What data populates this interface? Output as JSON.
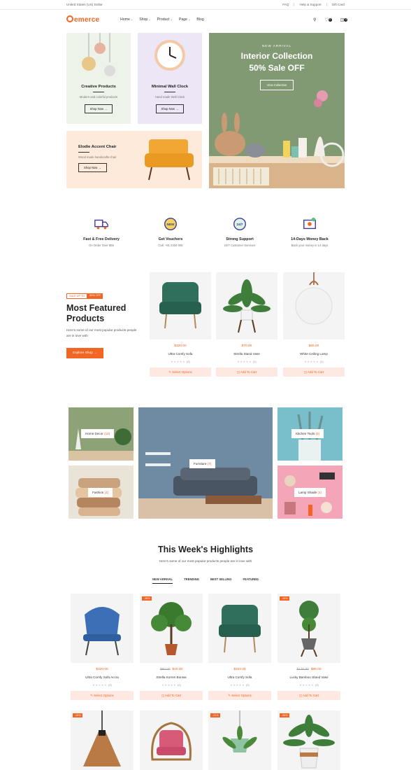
{
  "topbar": {
    "region": "United States (US) Dollar",
    "links": [
      "FAQ",
      "Help & Support",
      "Gift Card"
    ]
  },
  "header": {
    "logo": "emerce",
    "nav": [
      "Home",
      "Shop",
      "Product",
      "Page",
      "Blog"
    ],
    "wishlist_count": "0",
    "cart_count": "0"
  },
  "hero": {
    "card1": {
      "title": "Creative Products",
      "sub": "Modern and colorful products",
      "btn": "Shop Now"
    },
    "card2": {
      "title": "Minimal Wall Clock",
      "sub": "Hand made Wall Clock",
      "btn": "Shop Now"
    },
    "card3": {
      "title": "Elodie Accent Chair",
      "sub": "Wood made handicrafts chair",
      "btn": "Shop Now"
    },
    "main": {
      "eyebrow": "NEW ARRIVAL",
      "title1": "Interior Collection",
      "title2": "50% Sale OFF",
      "btn": "View Collection"
    }
  },
  "features": [
    {
      "title": "Fast & Free Delivery",
      "sub": "On Order Over $55"
    },
    {
      "title": "Get Vouchers",
      "sub": "Call: +91 2334 005"
    },
    {
      "title": "Strong Support",
      "sub": "24/7 Customer Services"
    },
    {
      "title": "14-Days Money Back",
      "sub": "Back your money in 14 days"
    }
  ],
  "featured": {
    "tag1": "SALE UP TO",
    "tag2": "50% OFF",
    "title1": "Most Featured",
    "title2": "Products",
    "desc": "Here's some of our most popular products people are in love with",
    "btn": "Explore Shop",
    "products": [
      {
        "price": "$320.00",
        "name": "Ultra Comfy Sofa",
        "reviews": "(0)",
        "action": "Select Options"
      },
      {
        "price": "$70.00",
        "name": "Strella Stand Vase",
        "reviews": "(0)",
        "action": "Add To Cart"
      },
      {
        "price": "$65.00",
        "name": "White Ceiling Lamp",
        "reviews": "(0)",
        "action": "Add To Cart"
      }
    ]
  },
  "categories": [
    {
      "name": "Home Decor",
      "count": "(10)"
    },
    {
      "name": "Fashion",
      "count": "(4)"
    },
    {
      "name": "Furniture",
      "count": "(7)"
    },
    {
      "name": "Kitchen Tools",
      "count": "(9)"
    },
    {
      "name": "Lamp Shade",
      "count": "(4)"
    }
  ],
  "highlights": {
    "title": "This Week's Highlights",
    "sub": "Here's some of our most popular products people are in love with",
    "tabs": [
      "NEW ARRIVAL",
      "TRENDING",
      "BEST SELLING",
      "FEATURED"
    ],
    "products": [
      {
        "discount": "",
        "old": "",
        "price": "$320.00",
        "name": "Ultra Comfy Sofa Accra",
        "reviews": "(0)",
        "action": "Select Options"
      },
      {
        "discount": "-20%",
        "old": "$50.00",
        "price": "$40.00",
        "name": "Strella Korres Bonsai",
        "reviews": "(0)",
        "action": "Add To Cart"
      },
      {
        "discount": "",
        "old": "",
        "price": "$320.00",
        "name": "Ultra Comfy Sofa",
        "reviews": "(0)",
        "action": "Select Options"
      },
      {
        "discount": "-10%",
        "old": "$130.00",
        "price": "$99.00",
        "name": "Lucky Bamboo Stand Vase",
        "reviews": "(0)",
        "action": "Add To Cart"
      }
    ],
    "row2_discounts": [
      "-10%",
      "",
      "-21%",
      "-30%"
    ]
  }
}
